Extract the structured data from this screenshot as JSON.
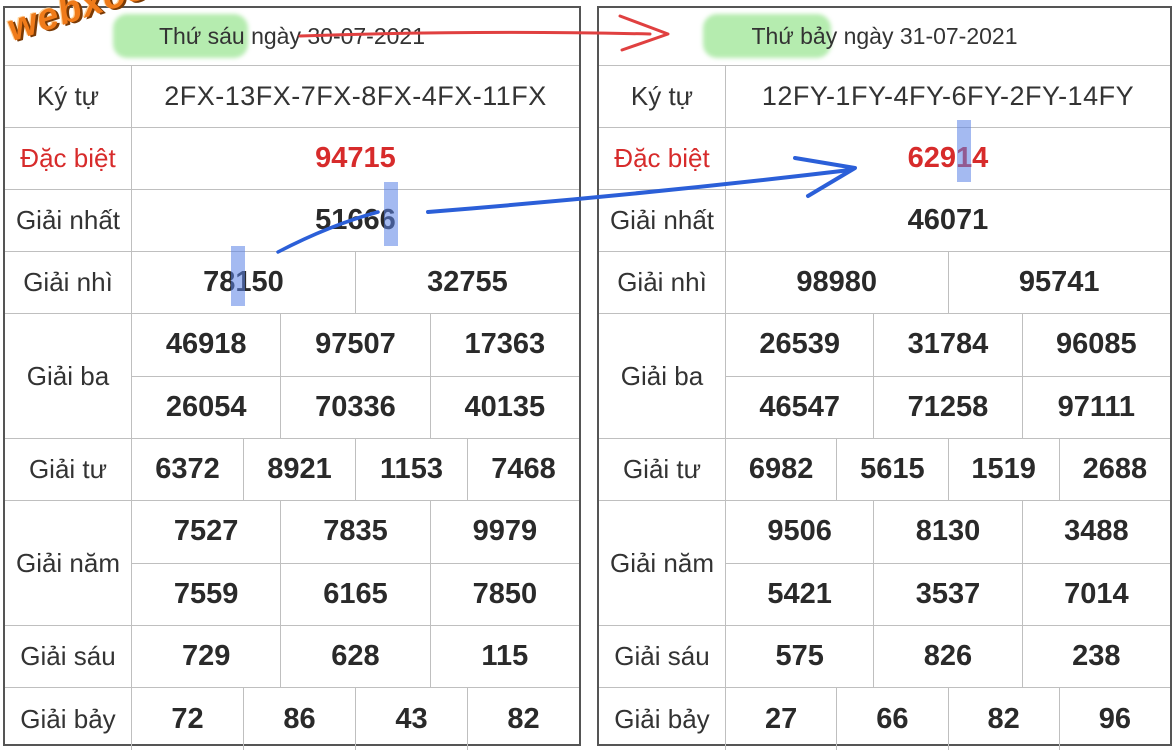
{
  "watermark": "webxoso.net",
  "colors": {
    "accent_red": "#d72b2b",
    "arrow_red": "#e04040",
    "arrow_blue": "#2b5fd8",
    "highlight_green": "#78dc6e"
  },
  "left": {
    "header": {
      "day": "Thứ sáu",
      "rest": " ngày 30-07-2021"
    },
    "rows": {
      "kytu": {
        "label": "Ký tự",
        "values": [
          "2FX-13FX-7FX-8FX-4FX-11FX"
        ]
      },
      "dacbiet": {
        "label": "Đặc biệt",
        "values": [
          "94715"
        ]
      },
      "nhat": {
        "label": "Giải nhất",
        "values": [
          "51666"
        ]
      },
      "nhi": {
        "label": "Giải nhì",
        "values": [
          "78150",
          "32755"
        ]
      },
      "ba": {
        "label": "Giải ba",
        "values": [
          "46918",
          "97507",
          "17363",
          "26054",
          "70336",
          "40135"
        ]
      },
      "tu": {
        "label": "Giải tư",
        "values": [
          "6372",
          "8921",
          "1153",
          "7468"
        ]
      },
      "nam": {
        "label": "Giải năm",
        "values": [
          "7527",
          "7835",
          "9979",
          "7559",
          "6165",
          "7850"
        ]
      },
      "sau": {
        "label": "Giải sáu",
        "values": [
          "729",
          "628",
          "115"
        ]
      },
      "bay": {
        "label": "Giải bảy",
        "values": [
          "72",
          "86",
          "43",
          "82"
        ]
      }
    }
  },
  "right": {
    "header": {
      "day": "Thứ bảy",
      "rest": " ngày 31-07-2021"
    },
    "rows": {
      "kytu": {
        "label": "Ký tự",
        "values": [
          "12FY-1FY-4FY-6FY-2FY-14FY"
        ]
      },
      "dacbiet": {
        "label": "Đặc biệt",
        "values": [
          "62914"
        ]
      },
      "nhat": {
        "label": "Giải nhất",
        "values": [
          "46071"
        ]
      },
      "nhi": {
        "label": "Giải nhì",
        "values": [
          "98980",
          "95741"
        ]
      },
      "ba": {
        "label": "Giải ba",
        "values": [
          "26539",
          "31784",
          "96085",
          "46547",
          "71258",
          "97111"
        ]
      },
      "tu": {
        "label": "Giải tư",
        "values": [
          "6982",
          "5615",
          "1519",
          "2688"
        ]
      },
      "nam": {
        "label": "Giải năm",
        "values": [
          "9506",
          "8130",
          "3488",
          "5421",
          "3537",
          "7014"
        ]
      },
      "sau": {
        "label": "Giải sáu",
        "values": [
          "575",
          "826",
          "238"
        ]
      },
      "bay": {
        "label": "Giải bảy",
        "values": [
          "27",
          "66",
          "82",
          "96"
        ]
      }
    }
  }
}
